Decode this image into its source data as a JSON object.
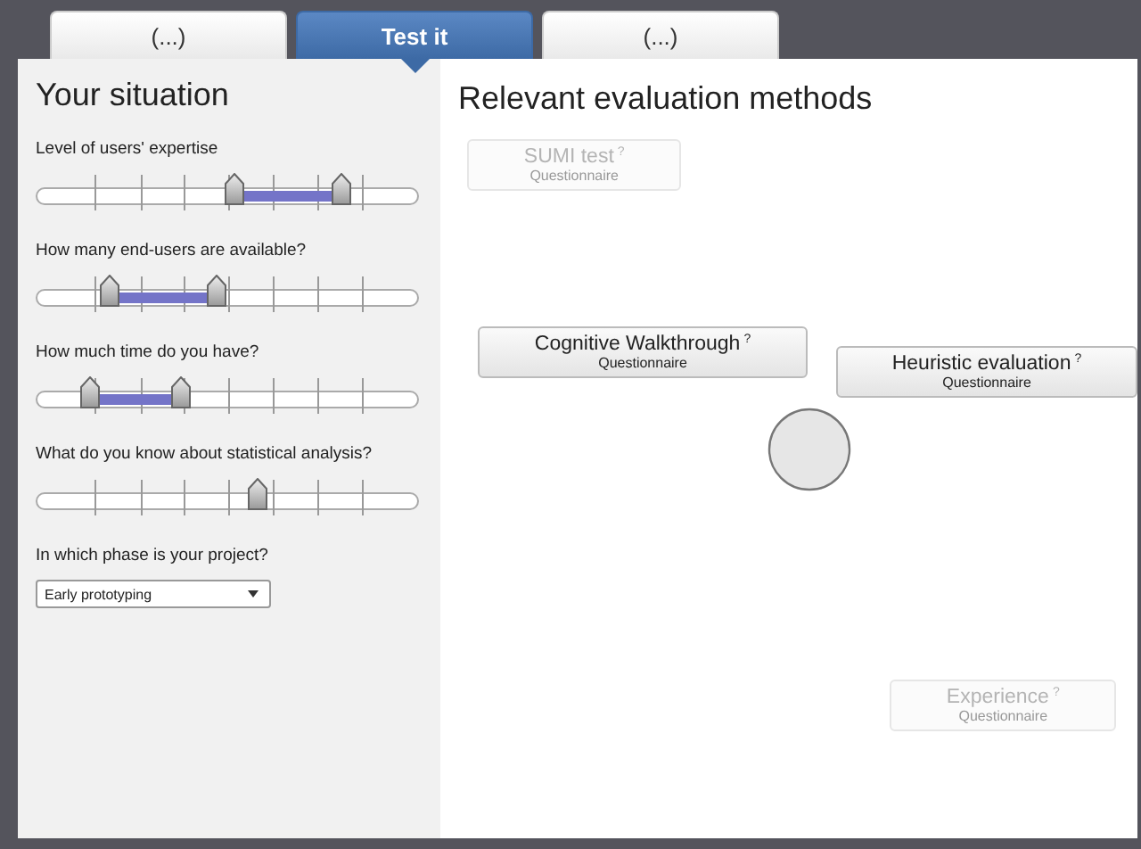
{
  "tabs": [
    {
      "label": "(...)",
      "selected": false
    },
    {
      "label": "Test it",
      "selected": true
    },
    {
      "label": "(...)",
      "selected": false
    }
  ],
  "situation": {
    "title": "Your situation",
    "sliders": [
      {
        "label": "Level of users' expertise",
        "handles": [
          {
            "level": 0.52
          },
          {
            "level": 0.8
          }
        ]
      },
      {
        "label": "How many end-users are available?",
        "handles": [
          {
            "level": 0.19
          },
          {
            "level": 0.47
          }
        ]
      },
      {
        "label": "How much time do you have?",
        "handles": [
          {
            "level": 0.14
          },
          {
            "level": 0.38
          }
        ]
      },
      {
        "label": "What do you know about statistical analysis?",
        "handles": [
          {
            "level": 0.58
          }
        ]
      }
    ],
    "phase": {
      "label": "In which phase is your project?",
      "value": "Early prototyping"
    }
  },
  "methods": {
    "title": "Relevant evaluation methods",
    "items": [
      {
        "name": "SUMI test",
        "type": "Questionnaire",
        "help": "?",
        "faded": true
      },
      {
        "name": "Cognitive Walkthrough",
        "type": "Questionnaire",
        "help": "?",
        "faded": false
      },
      {
        "name": "Heuristic evaluation",
        "type": "Questionnaire",
        "help": "?",
        "faded": false
      },
      {
        "name": "Experience",
        "type": "Questionnaire",
        "help": "?",
        "faded": true
      }
    ]
  }
}
